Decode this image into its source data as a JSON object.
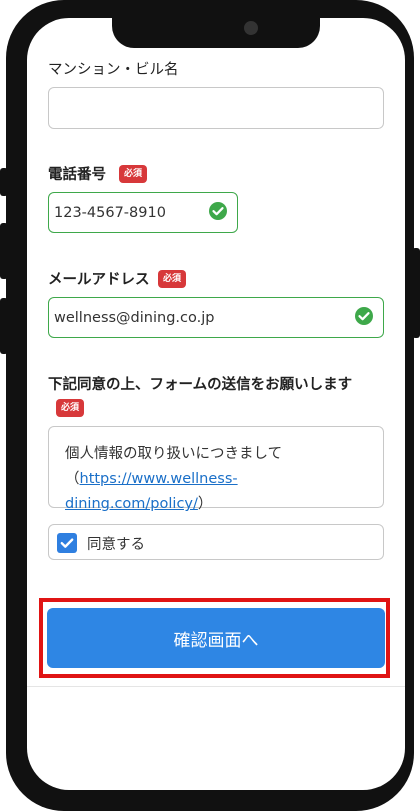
{
  "form": {
    "building_label": "マンション・ビル名",
    "building_value": "",
    "phone_label": "電話番号",
    "phone_value": "123-4567-8910",
    "email_label": "メールアドレス",
    "email_value": "wellness@dining.co.jp",
    "consent_heading": "下記同意の上、フォームの送信をお願いします",
    "required_badge": "必須"
  },
  "policy": {
    "text": "個人情報の取り扱いにつきまして",
    "open_paren": "（",
    "link_text": "https://www.wellness-dining.com/policy/",
    "close_paren": "）"
  },
  "agree": {
    "label": "同意する",
    "checked": true
  },
  "submit": {
    "label": "確認画面へ"
  },
  "colors": {
    "valid_green": "#3ea84a",
    "required_red": "#d7383a",
    "primary_blue": "#2e86e4",
    "highlight_red": "#e01414",
    "link_blue": "#1a6fc8"
  }
}
